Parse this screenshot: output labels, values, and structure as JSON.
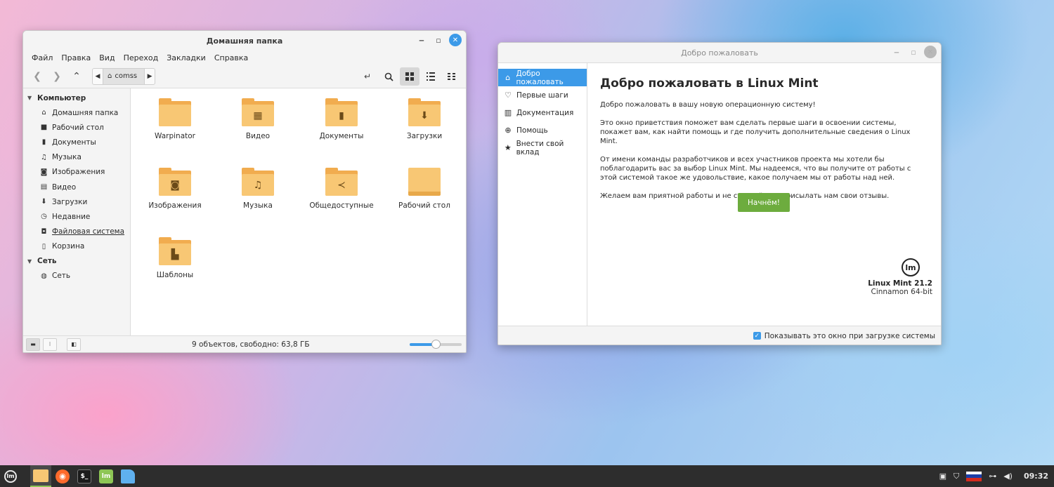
{
  "file_manager": {
    "title": "Домашняя папка",
    "menu": [
      "Файл",
      "Правка",
      "Вид",
      "Переход",
      "Закладки",
      "Справка"
    ],
    "breadcrumb": "comss",
    "sidebar": {
      "computer_header": "Компьютер",
      "computer_items": [
        {
          "label": "Домашняя папка",
          "icon": "home-icon"
        },
        {
          "label": "Рабочий стол",
          "icon": "desktop-icon"
        },
        {
          "label": "Документы",
          "icon": "document-icon"
        },
        {
          "label": "Музыка",
          "icon": "music-icon"
        },
        {
          "label": "Изображения",
          "icon": "camera-icon"
        },
        {
          "label": "Видео",
          "icon": "film-icon"
        },
        {
          "label": "Загрузки",
          "icon": "download-icon"
        },
        {
          "label": "Недавние",
          "icon": "clock-icon"
        },
        {
          "label": "Файловая система",
          "icon": "drive-icon"
        },
        {
          "label": "Корзина",
          "icon": "trash-icon"
        }
      ],
      "network_header": "Сеть",
      "network_items": [
        {
          "label": "Сеть",
          "icon": "globe-icon"
        }
      ]
    },
    "files": [
      {
        "label": "Warpinator",
        "icon": "folder-icon"
      },
      {
        "label": "Видео",
        "icon": "folder-video-icon"
      },
      {
        "label": "Документы",
        "icon": "folder-documents-icon"
      },
      {
        "label": "Загрузки",
        "icon": "folder-download-icon"
      },
      {
        "label": "Изображения",
        "icon": "folder-pictures-icon"
      },
      {
        "label": "Музыка",
        "icon": "folder-music-icon"
      },
      {
        "label": "Общедоступные",
        "icon": "folder-share-icon"
      },
      {
        "label": "Рабочий стол",
        "icon": "folder-desktop-icon"
      },
      {
        "label": "Шаблоны",
        "icon": "folder-templates-icon"
      }
    ],
    "status": "9 объектов, свободно: 63,8 ГБ",
    "zoom_level": 0.5
  },
  "welcome": {
    "title": "Добро пожаловать",
    "sidebar": [
      {
        "label": "Добро пожаловать",
        "icon": "home-icon"
      },
      {
        "label": "Первые шаги",
        "icon": "lightbulb-icon"
      },
      {
        "label": "Документация",
        "icon": "book-icon"
      },
      {
        "label": "Помощь",
        "icon": "lifebuoy-icon"
      },
      {
        "label": "Внести свой вклад",
        "icon": "star-icon"
      }
    ],
    "heading": "Добро пожаловать в Linux Mint",
    "paragraphs": [
      "Добро пожаловать в вашу новую операционную систему!",
      "Это окно приветствия поможет вам сделать первые шаги в освоении системы, покажет вам, как найти помощь и где получить дополнительные сведения о Linux Mint.",
      "От имени команды разработчиков и всех участников проекта мы хотели бы поблагодарить вас за выбор Linux Mint. Мы надеемся, что вы получите от работы с этой системой такое же удовольствие, какое получаем мы от работы над ней.",
      "Желаем вам приятной работы и не стесняйтесь присылать нам свои отзывы."
    ],
    "start_button": "Начнём!",
    "version": "Linux Mint 21.2",
    "edition": "Cinnamon 64-bit",
    "show_on_startup": "Показывать это окно при загрузке системы"
  },
  "taskbar": {
    "clock": "09:32",
    "colors": {
      "accent": "#3c9ae8",
      "mint_green": "#8ec655",
      "folder": "#f8c774"
    }
  }
}
